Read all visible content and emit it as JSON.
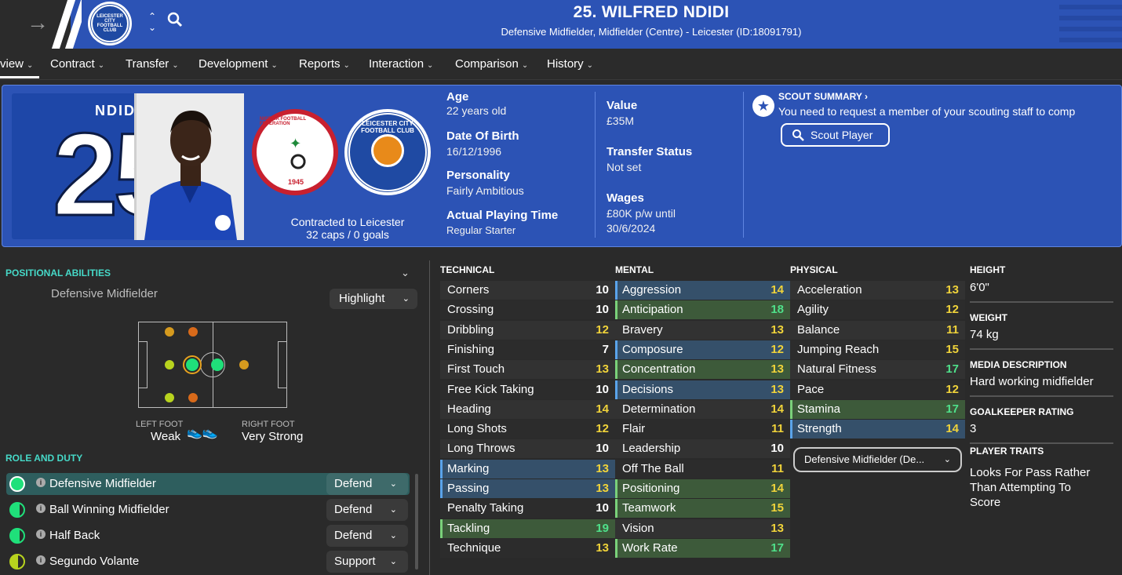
{
  "header": {
    "title": "25. WILFRED NDIDI",
    "subtitle": "Defensive Midfielder, Midfielder (Centre) - Leicester (ID:18091791)",
    "club_crest_text": "LEICESTER CITY FOOTBALL CLUB"
  },
  "nav": {
    "items": [
      {
        "label": "view"
      },
      {
        "label": "Contract"
      },
      {
        "label": "Transfer"
      },
      {
        "label": "Development"
      },
      {
        "label": "Reports"
      },
      {
        "label": "Interaction"
      },
      {
        "label": "Comparison"
      },
      {
        "label": "History"
      }
    ]
  },
  "profile": {
    "shirt_name": "NDIDI",
    "shirt_number": "25",
    "national_crest_text": "NIGERIA FOOTBALL FEDERATION",
    "national_crest_year": "1945",
    "club_crest_text": "LEICESTER CITY FOOTBALL CLUB",
    "contracted_to": "Contracted to Leicester",
    "caps": "32 caps / 0 goals",
    "age_label": "Age",
    "age": "22 years old",
    "dob_label": "Date Of Birth",
    "dob": "16/12/1996",
    "personality_label": "Personality",
    "personality": "Fairly Ambitious",
    "playing_time_label": "Actual Playing Time",
    "playing_time": "Regular Starter",
    "value_label": "Value",
    "value": "£35M",
    "transfer_status_label": "Transfer Status",
    "transfer_status": "Not set",
    "wages_label": "Wages",
    "wages_line1": "£80K p/w until",
    "wages_line2": "30/6/2024"
  },
  "scout": {
    "title": "SCOUT SUMMARY",
    "text": "You need to request a member of your scouting staff to comp",
    "button": "Scout Player"
  },
  "positional": {
    "title": "POSITIONAL ABILITIES",
    "position": "Defensive Midfielder",
    "highlight": "Highlight",
    "left_foot_label": "LEFT FOOT",
    "left_foot": "Weak",
    "right_foot_label": "RIGHT FOOT",
    "right_foot": "Very Strong"
  },
  "roles": {
    "title": "ROLE AND DUTY",
    "items": [
      {
        "name": "Defensive Midfielder",
        "duty": "Defend",
        "selected": true
      },
      {
        "name": "Ball Winning Midfielder",
        "duty": "Defend",
        "selected": false
      },
      {
        "name": "Half Back",
        "duty": "Defend",
        "selected": false
      },
      {
        "name": "Segundo Volante",
        "duty": "Support",
        "selected": false
      }
    ]
  },
  "technical": {
    "title": "TECHNICAL",
    "attrs": [
      {
        "name": "Corners",
        "value": "10",
        "hl": ""
      },
      {
        "name": "Crossing",
        "value": "10",
        "hl": ""
      },
      {
        "name": "Dribbling",
        "value": "12",
        "hl": ""
      },
      {
        "name": "Finishing",
        "value": "7",
        "hl": ""
      },
      {
        "name": "First Touch",
        "value": "13",
        "hl": ""
      },
      {
        "name": "Free Kick Taking",
        "value": "10",
        "hl": ""
      },
      {
        "name": "Heading",
        "value": "14",
        "hl": ""
      },
      {
        "name": "Long Shots",
        "value": "12",
        "hl": ""
      },
      {
        "name": "Long Throws",
        "value": "10",
        "hl": ""
      },
      {
        "name": "Marking",
        "value": "13",
        "hl": "blue"
      },
      {
        "name": "Passing",
        "value": "13",
        "hl": "blue"
      },
      {
        "name": "Penalty Taking",
        "value": "10",
        "hl": ""
      },
      {
        "name": "Tackling",
        "value": "19",
        "hl": "green"
      },
      {
        "name": "Technique",
        "value": "13",
        "hl": ""
      }
    ]
  },
  "mental": {
    "title": "MENTAL",
    "attrs": [
      {
        "name": "Aggression",
        "value": "14",
        "hl": "blue"
      },
      {
        "name": "Anticipation",
        "value": "18",
        "hl": "green"
      },
      {
        "name": "Bravery",
        "value": "13",
        "hl": ""
      },
      {
        "name": "Composure",
        "value": "12",
        "hl": "blue"
      },
      {
        "name": "Concentration",
        "value": "13",
        "hl": "green"
      },
      {
        "name": "Decisions",
        "value": "13",
        "hl": "blue"
      },
      {
        "name": "Determination",
        "value": "14",
        "hl": ""
      },
      {
        "name": "Flair",
        "value": "11",
        "hl": ""
      },
      {
        "name": "Leadership",
        "value": "10",
        "hl": ""
      },
      {
        "name": "Off The Ball",
        "value": "11",
        "hl": ""
      },
      {
        "name": "Positioning",
        "value": "14",
        "hl": "green"
      },
      {
        "name": "Teamwork",
        "value": "15",
        "hl": "green"
      },
      {
        "name": "Vision",
        "value": "13",
        "hl": ""
      },
      {
        "name": "Work Rate",
        "value": "17",
        "hl": "green"
      }
    ]
  },
  "physical": {
    "title": "PHYSICAL",
    "attrs": [
      {
        "name": "Acceleration",
        "value": "13",
        "hl": ""
      },
      {
        "name": "Agility",
        "value": "12",
        "hl": ""
      },
      {
        "name": "Balance",
        "value": "11",
        "hl": ""
      },
      {
        "name": "Jumping Reach",
        "value": "15",
        "hl": ""
      },
      {
        "name": "Natural Fitness",
        "value": "17",
        "hl": ""
      },
      {
        "name": "Pace",
        "value": "12",
        "hl": ""
      },
      {
        "name": "Stamina",
        "value": "17",
        "hl": "green"
      },
      {
        "name": "Strength",
        "value": "14",
        "hl": "blue"
      }
    ],
    "role_dropdown": "Defensive Midfielder (De..."
  },
  "details": {
    "height_label": "HEIGHT",
    "height": "6'0\"",
    "weight_label": "WEIGHT",
    "weight": "74 kg",
    "media_label": "MEDIA DESCRIPTION",
    "media": "Hard working midfielder",
    "gk_label": "GOALKEEPER RATING",
    "gk": "3",
    "traits_label": "PLAYER TRAITS",
    "traits": "Looks For Pass Rather Than Attempting To Score"
  },
  "colors": {
    "brand_blue": "#2c53b5",
    "accent_teal": "#46d9c8",
    "value_white": "#ffffff",
    "value_yellow": "#f0d33a",
    "value_green": "#4fe08a"
  }
}
